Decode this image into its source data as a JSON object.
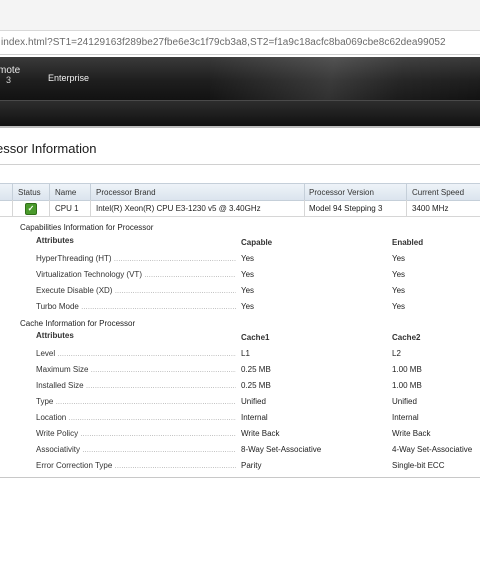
{
  "browser": {
    "url": "index.html?ST1=24129163f289be27fbe6e3c1f79cb3a8,ST2=f1a9c18acfc8ba069cbe8c62dea99052"
  },
  "header": {
    "brand_line1": "mote",
    "brand_line2": "3",
    "edition": "Enterprise"
  },
  "page": {
    "title": "essor Information"
  },
  "processor_table": {
    "columns": [
      "Status",
      "Name",
      "Processor Brand",
      "Processor Version",
      "Current Speed"
    ],
    "row": {
      "status": "ok",
      "name": "CPU 1",
      "brand": "Intel(R) Xeon(R) CPU E3-1230 v5 @ 3.40GHz",
      "version": "Model 94 Stepping 3",
      "speed": "3400 MHz"
    }
  },
  "capabilities": {
    "title": "Capabilities Information for Processor",
    "headers": [
      "Attributes",
      "Capable",
      "Enabled"
    ],
    "rows": [
      {
        "attr": "HyperThreading (HT)",
        "capable": "Yes",
        "enabled": "Yes"
      },
      {
        "attr": "Virtualization Technology (VT)",
        "capable": "Yes",
        "enabled": "Yes"
      },
      {
        "attr": "Execute Disable (XD)",
        "capable": "Yes",
        "enabled": "Yes"
      },
      {
        "attr": "Turbo Mode",
        "capable": "Yes",
        "enabled": "Yes"
      }
    ]
  },
  "cache": {
    "title": "Cache Information for Processor",
    "headers": [
      "Attributes",
      "Cache1",
      "Cache2"
    ],
    "rows": [
      {
        "attr": "Level",
        "c1": "L1",
        "c2": "L2"
      },
      {
        "attr": "Maximum Size",
        "c1": "0.25 MB",
        "c2": "1.00 MB"
      },
      {
        "attr": "Installed Size",
        "c1": "0.25 MB",
        "c2": "1.00 MB"
      },
      {
        "attr": "Type",
        "c1": "Unified",
        "c2": "Unified"
      },
      {
        "attr": "Location",
        "c1": "Internal",
        "c2": "Internal"
      },
      {
        "attr": "Write Policy",
        "c1": "Write Back",
        "c2": "Write Back"
      },
      {
        "attr": "Associativity",
        "c1": "8-Way Set-Associative",
        "c2": "4-Way Set-Associative"
      },
      {
        "attr": "Error Correction Type",
        "c1": "Parity",
        "c2": "Single-bit ECC"
      }
    ]
  }
}
